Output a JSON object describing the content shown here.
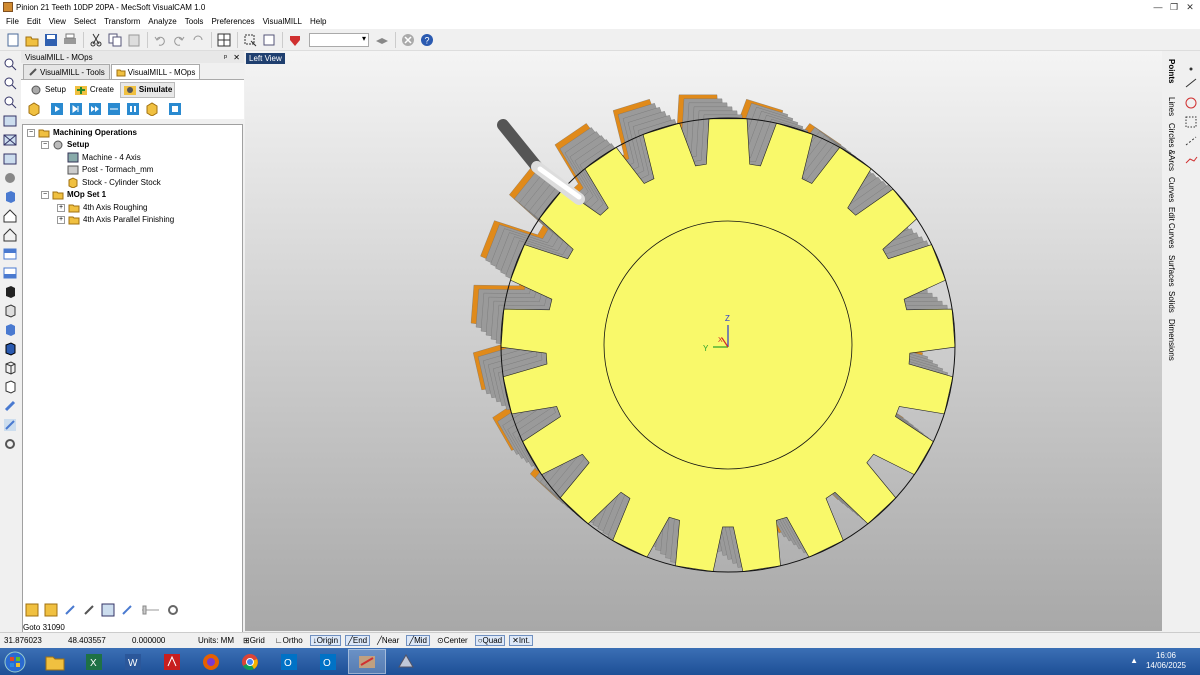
{
  "window": {
    "title": "Pinion 21 Teeth 10DP 20PA - MecSoft VisualCAM 1.0"
  },
  "menu": [
    "File",
    "Edit",
    "View",
    "Select",
    "Transform",
    "Analyze",
    "Tools",
    "Preferences",
    "VisualMILL",
    "Help"
  ],
  "panel": {
    "header": "VisualMILL - MOps",
    "pin": "ᵖ",
    "close": "✕",
    "tabs": [
      "VisualMILL - Tools",
      "VisualMILL - MOps"
    ],
    "subtabs": [
      "Setup",
      "Create",
      "Simulate"
    ],
    "tree": {
      "root": "Machining Operations",
      "setup": "Setup",
      "machine": "Machine - 4 Axis",
      "post": "Post - Tormach_mm",
      "stock": "Stock - Cylinder Stock",
      "mopset": "MOp Set 1",
      "op1": "4th Axis Roughing",
      "op2": "4th Axis Parallel Finishing"
    },
    "goto": "Goto 31090"
  },
  "viewport": {
    "label": "Left View",
    "axis_z": "Z",
    "axis_y": "Y",
    "axis_x": "X"
  },
  "rightbar": [
    "Points",
    "Lines",
    "Circles &Arcs",
    "Curves",
    "Edit Curves",
    "Surfaces",
    "Solids",
    "Dimensions"
  ],
  "status": {
    "x": "31.876023",
    "y": "48.403557",
    "z": "0.000000",
    "units": "Units: MM",
    "snaps": [
      "Grid",
      "Ortho",
      "Origin",
      "End",
      "Near",
      "Mid",
      "Center",
      "Quad",
      "Int."
    ]
  },
  "clock": {
    "time": "16:06",
    "date": "14/06/2025"
  },
  "colors": {
    "gear": "#f9f96a",
    "gear_side": "#8a8a8a",
    "teeth_edge": "#e08a1a",
    "viewport_top": "#f4f4f4",
    "viewport_bottom": "#a8a8a8"
  }
}
